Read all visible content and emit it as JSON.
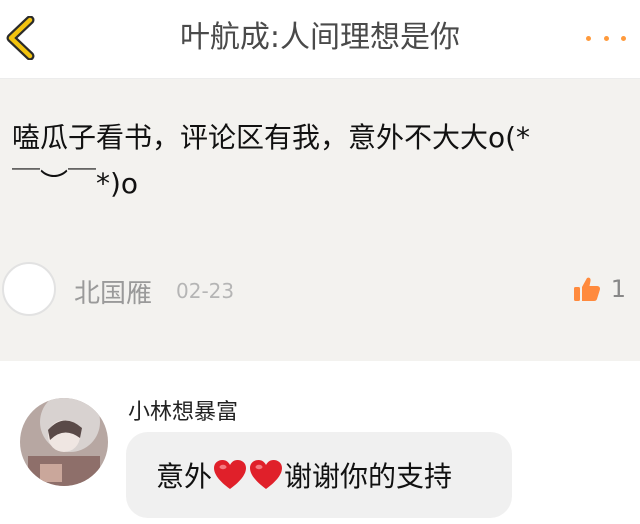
{
  "header": {
    "title": "叶航成:人间理想是你",
    "back_icon": "chevron-left-icon",
    "more_icon": "more-dots-icon"
  },
  "comment": {
    "text": "嗑瓜子看书，评论区有我，意外不大大o(*\n￣︶￣*)o",
    "author": "北国雁",
    "date": "02-23",
    "like_icon": "thumbs-up-icon",
    "like_count": "1"
  },
  "reply": {
    "author": "小林想暴富",
    "text_before": "意外",
    "text_after": "谢谢你的支持",
    "hearts_icon": "red-heart-icon"
  },
  "colors": {
    "accent": "#ff9a3c",
    "comment_bg": "#f3f2ef",
    "bubble_bg": "#f0f0f0",
    "heart": "#e0202a"
  }
}
